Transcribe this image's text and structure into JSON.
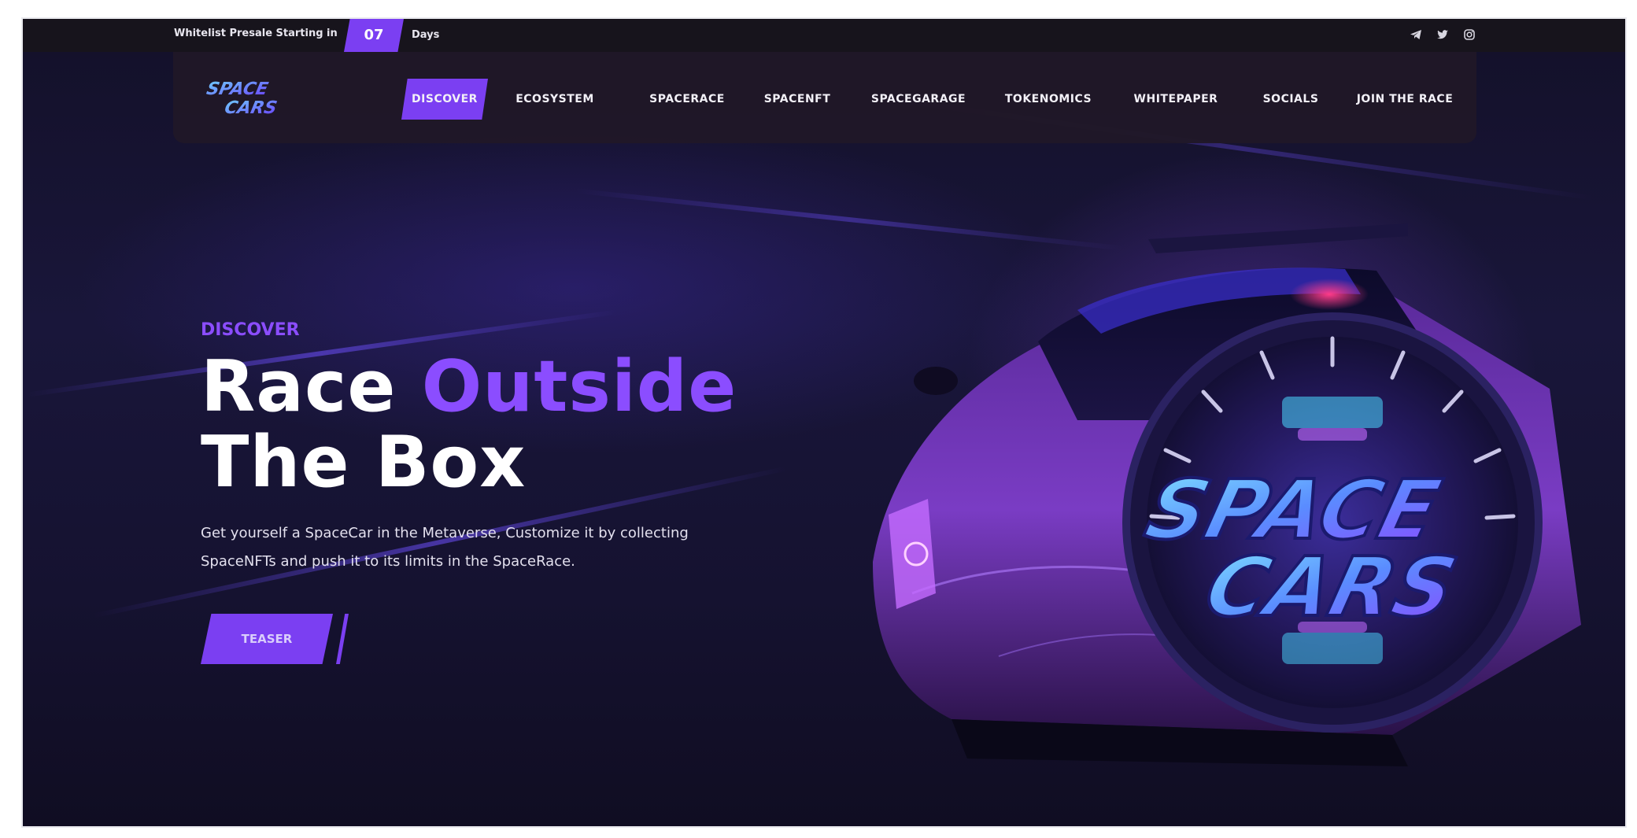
{
  "topbar": {
    "presale_text": "Whitelist Presale Starting in",
    "days_value": "07",
    "days_label": "Days",
    "socials": [
      "telegram-icon",
      "twitter-icon",
      "instagram-icon"
    ]
  },
  "nav": {
    "logo_text": "SPACE CARS",
    "items": [
      {
        "label": "DISCOVER",
        "active": true
      },
      {
        "label": "ECOSYSTEM"
      },
      {
        "label": "SPACERACE"
      },
      {
        "label": "SPACENFT"
      },
      {
        "label": "SPACEGARAGE"
      },
      {
        "label": "TOKENOMICS"
      },
      {
        "label": "WHITEPAPER"
      },
      {
        "label": "SOCIALS"
      },
      {
        "label": "JOIN THE RACE"
      }
    ]
  },
  "hero": {
    "eyebrow": "DISCOVER",
    "headline_part1": "Race ",
    "headline_accent": "Outside",
    "headline_line2": "The Box",
    "subtext": "Get yourself a SpaceCar in the Metaverse, Customize it by collecting SpaceNFTs and push it to its limits in the SpaceRace.",
    "teaser_label": "TEASER"
  },
  "badge": {
    "line1": "SPACE",
    "line2": "CARS"
  },
  "colors": {
    "accent": "#7b3ff2",
    "accent_text": "#8b4dff",
    "background": "#131026",
    "nav_bg": "#201828"
  }
}
